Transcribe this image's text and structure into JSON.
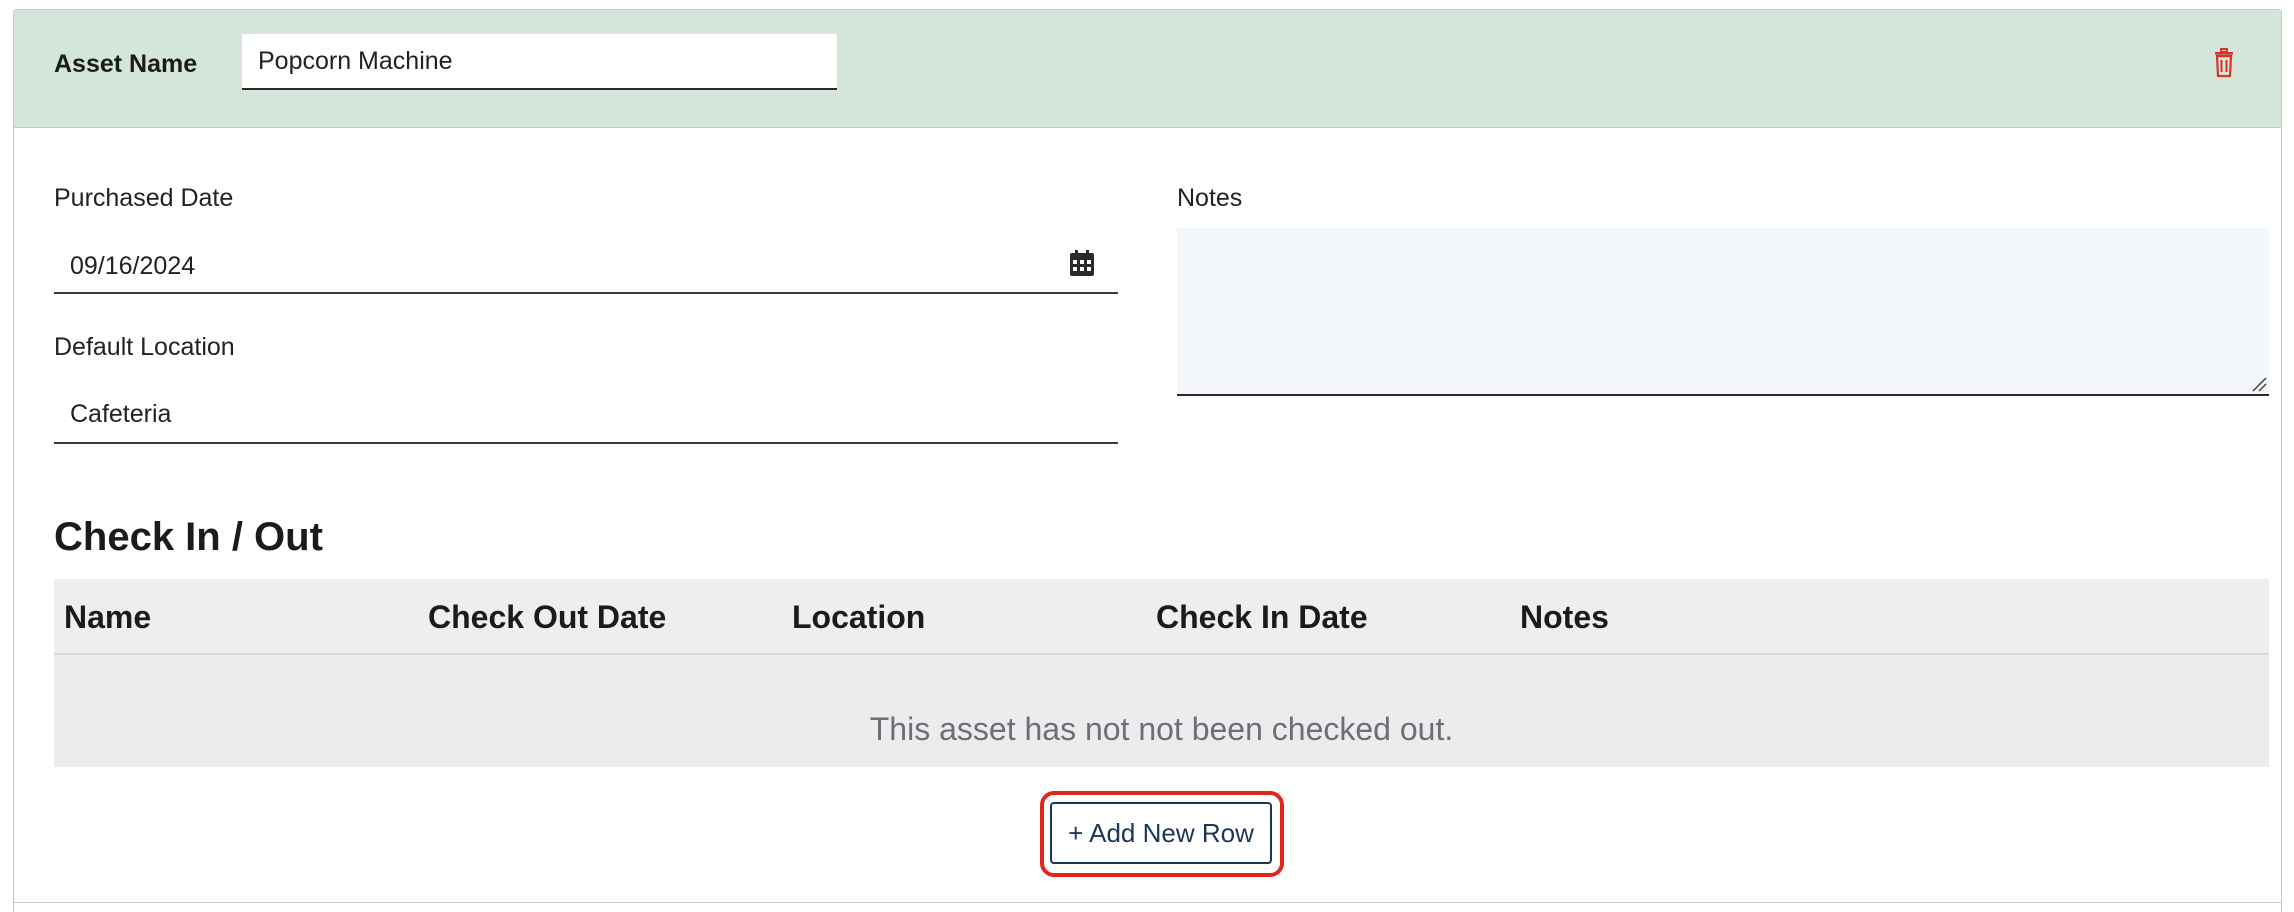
{
  "header": {
    "asset_label": "Asset Name",
    "asset_value": "Popcorn Machine",
    "delete_icon": "trash-icon"
  },
  "form": {
    "purchased_label": "Purchased Date",
    "purchased_value": "09/16/2024",
    "calendar_icon": "calendar-icon",
    "location_label": "Default Location",
    "location_value": "Cafeteria",
    "notes_label": "Notes",
    "notes_value": ""
  },
  "checkinout": {
    "title": "Check In / Out",
    "columns": [
      "Name",
      "Check Out Date",
      "Location",
      "Check In Date",
      "Notes"
    ],
    "empty_message": "This asset has not not been checked out.",
    "add_button": "+ Add New Row"
  },
  "colors": {
    "header_bg": "#d4e5da",
    "delete_red": "#d9322b",
    "button_navy": "#1d3557",
    "highlight_red": "#e2261c"
  }
}
